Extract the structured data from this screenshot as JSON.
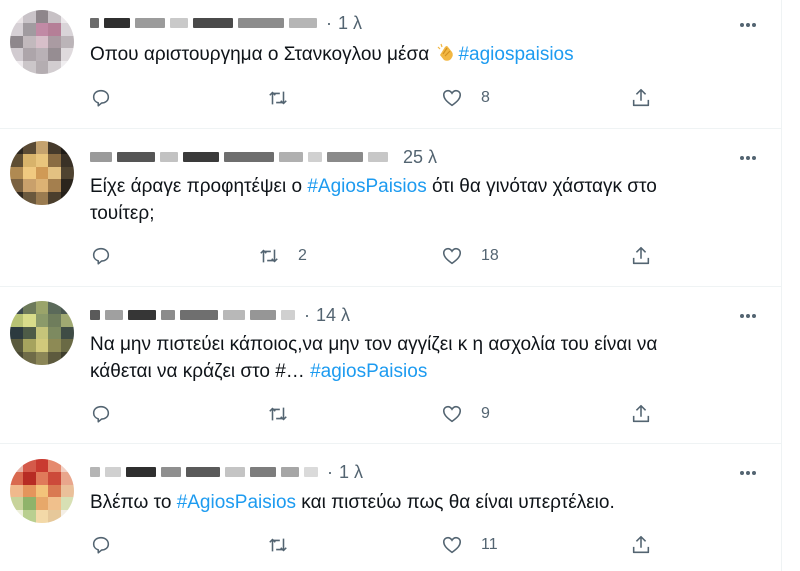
{
  "tweets": [
    {
      "time": "1 λ",
      "text_before": "Οπου αριστουργημα ο Στανκογλου μέσα ",
      "text_after": "",
      "text_second": "",
      "hashtag": "#agiospaisios",
      "reply_count": "",
      "retweet_count": "",
      "like_count": "8"
    },
    {
      "time": "25 λ",
      "text_before": "Είχε άραγε προφητέψει ο ",
      "hashtag": "#AgiosPaisios",
      "text_after": " ότι θα γινόταν χάσταγκ στο",
      "text_second": "τουίτερ;",
      "reply_count": "",
      "retweet_count": "2",
      "like_count": "18"
    },
    {
      "time": "14 λ",
      "text_before": "Να μην πιστεύει κάποιος,να μην τον αγγίζει κ η ασχολία του είναι να",
      "text_second": "κάθεται να κράζει στο #… ",
      "hashtag": "#agiosPaisios",
      "text_after": "",
      "reply_count": "",
      "retweet_count": "",
      "like_count": "9"
    },
    {
      "time": "1 λ",
      "text_before": "Βλέπω το ",
      "hashtag": "#AgiosPaisios",
      "text_after": " και πιστεύω πως θα είναι υπερτέλειο.",
      "text_second": "",
      "reply_count": "",
      "retweet_count": "",
      "like_count": "11"
    }
  ],
  "icons": {
    "reply": "reply-icon",
    "retweet": "retweet-icon",
    "like": "heart-icon",
    "share": "share-icon",
    "more": "more-icon",
    "emoji": "clapping-hands-emoji"
  },
  "colors": {
    "hashtag": "#1d9bf0",
    "secondary_text": "#536471",
    "primary_text": "#0f1419",
    "divider": "#eff3f4"
  }
}
